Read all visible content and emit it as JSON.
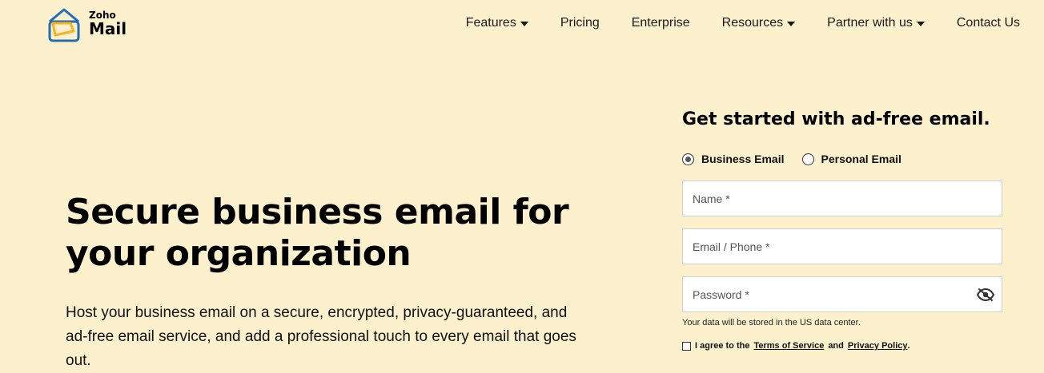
{
  "brand": {
    "line1": "Zoho",
    "line2": "Mail",
    "logo_icon": "zoho-mail-envelope-logo",
    "accent_blue": "#226db4",
    "accent_yellow": "#f9b21d"
  },
  "nav": {
    "items": [
      {
        "label": "Features",
        "dropdown": true
      },
      {
        "label": "Pricing",
        "dropdown": false
      },
      {
        "label": "Enterprise",
        "dropdown": false
      },
      {
        "label": "Resources",
        "dropdown": true
      },
      {
        "label": "Partner with us",
        "dropdown": true
      },
      {
        "label": "Contact Us",
        "dropdown": false
      }
    ]
  },
  "hero": {
    "title": "Secure business email for your organization",
    "description": "Host your business email on a secure, encrypted, privacy-guaranteed, and ad-free email service, and add a professional touch to every email that goes out."
  },
  "signup": {
    "title": "Get started with ad-free email.",
    "options": [
      {
        "label": "Business Email",
        "selected": true
      },
      {
        "label": "Personal Email",
        "selected": false
      }
    ],
    "fields": {
      "name_placeholder": "Name *",
      "email_placeholder": "Email / Phone *",
      "password_placeholder": "Password *"
    },
    "data_note": "Your data will be stored in the US data center.",
    "agree": {
      "prefix": "I agree to the",
      "terms": "Terms of Service",
      "and": "and",
      "privacy": "Privacy Policy",
      "suffix": "."
    }
  },
  "colors": {
    "background": "#fdf0cc"
  }
}
